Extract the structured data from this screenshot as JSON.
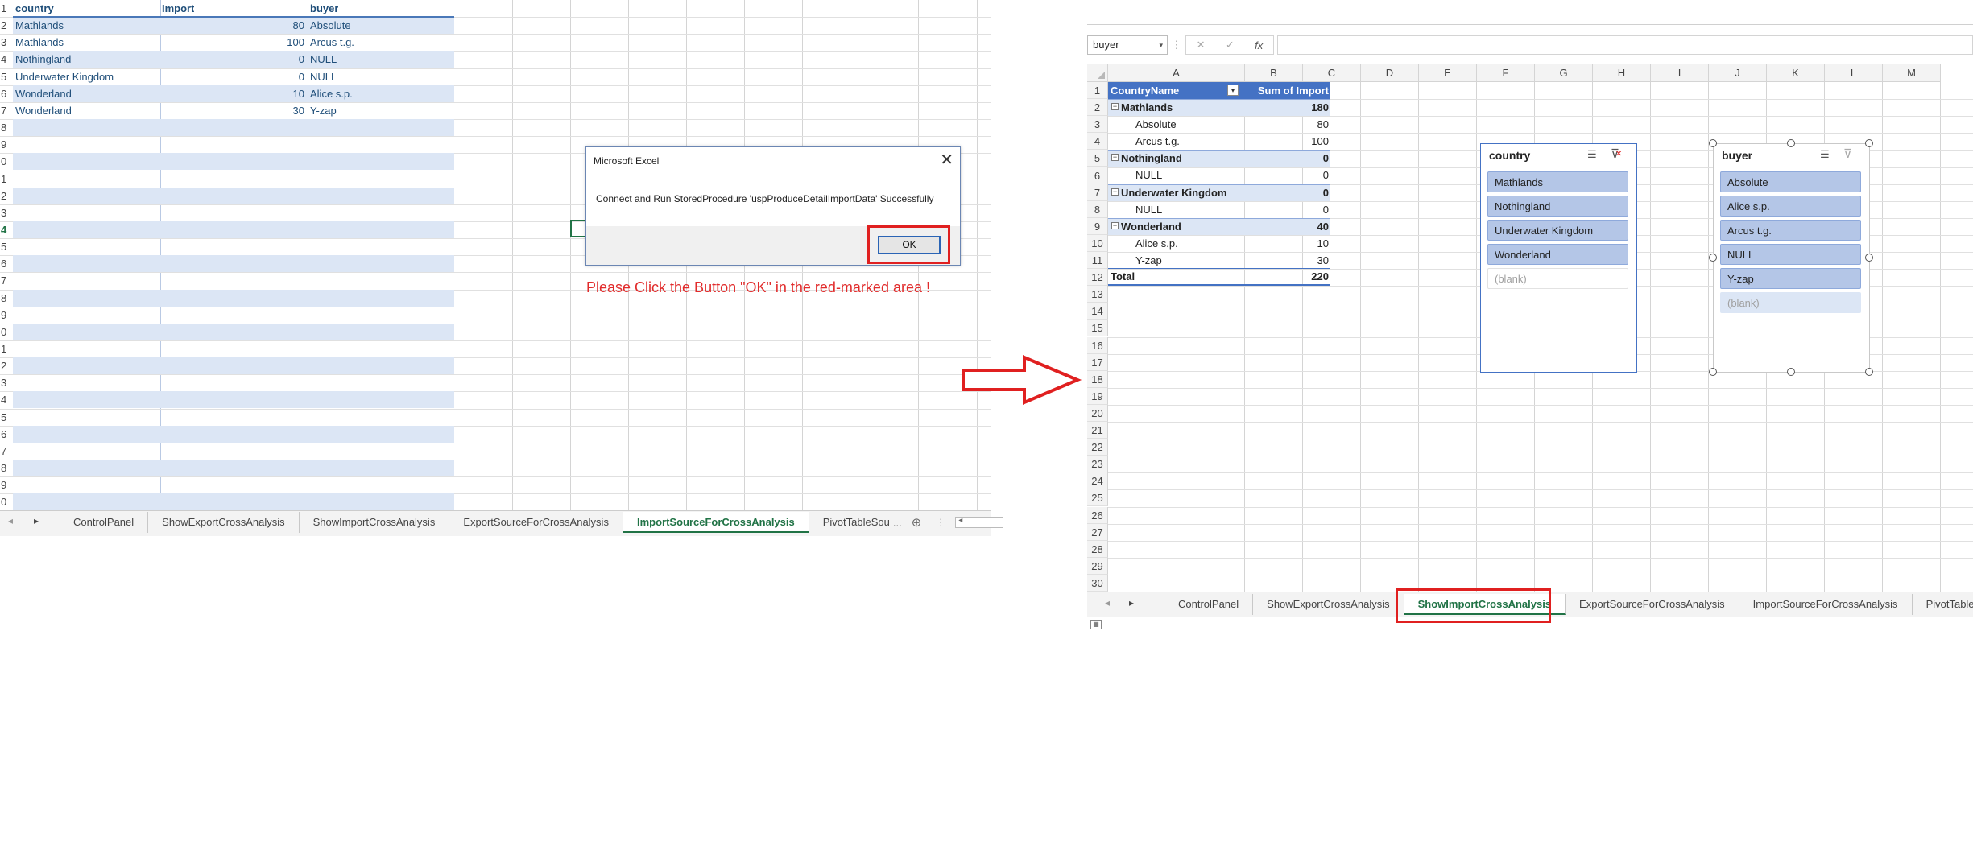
{
  "left": {
    "headers": [
      "country",
      "Import",
      "buyer"
    ],
    "rows": [
      {
        "country": "Mathlands",
        "import": "80",
        "buyer": "Absolute"
      },
      {
        "country": "Mathlands",
        "import": "100",
        "buyer": "Arcus t.g."
      },
      {
        "country": "Nothingland",
        "import": "0",
        "buyer": "NULL"
      },
      {
        "country": "Underwater Kingdom",
        "import": "0",
        "buyer": "NULL"
      },
      {
        "country": "Wonderland",
        "import": "10",
        "buyer": "Alice s.p."
      },
      {
        "country": "Wonderland",
        "import": "30",
        "buyer": "Y-zap"
      }
    ],
    "row_numbers": [
      "1",
      "2",
      "3",
      "4",
      "5",
      "6",
      "7",
      "8",
      "9",
      "0",
      "1",
      "2",
      "3",
      "4",
      "5",
      "6",
      "7",
      "8",
      "9",
      "0",
      "1",
      "2",
      "3",
      "4",
      "5",
      "6",
      "7",
      "8",
      "9",
      "0"
    ],
    "tabs": [
      "ControlPanel",
      "ShowExportCrossAnalysis",
      "ShowImportCrossAnalysis",
      "ExportSourceForCrossAnalysis",
      "ImportSourceForCrossAnalysis",
      "PivotTableSou"
    ],
    "tab_more": "..."
  },
  "dialog": {
    "title": "Microsoft Excel",
    "message": "Connect and Run StoredProcedure 'uspProduceDetailImportData' Successfully",
    "ok_label": "OK"
  },
  "note": "Please Click the Button \"OK\" in the red-marked area !",
  "right": {
    "name_box": "buyer",
    "fx": "fx",
    "columns": [
      "A",
      "B",
      "C",
      "D",
      "E",
      "F",
      "G",
      "H",
      "I",
      "J",
      "K",
      "L",
      "M"
    ],
    "row_numbers": [
      "1",
      "2",
      "3",
      "4",
      "5",
      "6",
      "7",
      "8",
      "9",
      "10",
      "11",
      "12",
      "13",
      "14",
      "15",
      "16",
      "17",
      "18",
      "19",
      "20",
      "21",
      "22",
      "23",
      "24",
      "25",
      "26",
      "27",
      "28",
      "29",
      "30"
    ],
    "pivot": {
      "header_row": [
        "CountryName",
        "Sum of Import"
      ],
      "rows": [
        {
          "label": "Mathlands",
          "value": "180",
          "group": true
        },
        {
          "label": "Absolute",
          "value": "80",
          "group": false
        },
        {
          "label": "Arcus t.g.",
          "value": "100",
          "group": false
        },
        {
          "label": "Nothingland",
          "value": "0",
          "group": true
        },
        {
          "label": "NULL",
          "value": "0",
          "group": false
        },
        {
          "label": "Underwater Kingdom",
          "value": "0",
          "group": true
        },
        {
          "label": "NULL",
          "value": "0",
          "group": false
        },
        {
          "label": "Wonderland",
          "value": "40",
          "group": true
        },
        {
          "label": "Alice s.p.",
          "value": "10",
          "group": false
        },
        {
          "label": "Y-zap",
          "value": "30",
          "group": false
        }
      ],
      "total_label": "Total",
      "total_value": "220"
    },
    "slicer_country": {
      "title": "country",
      "items": [
        "Mathlands",
        "Nothingland",
        "Underwater Kingdom",
        "Wonderland",
        "(blank)"
      ]
    },
    "slicer_buyer": {
      "title": "buyer",
      "items": [
        "Absolute",
        "Alice s.p.",
        "Arcus t.g.",
        "NULL",
        "Y-zap",
        "(blank)"
      ]
    },
    "tabs": [
      "ControlPanel",
      "ShowExportCrossAnalysis",
      "ShowImportCrossAnalysis",
      "ExportSourceForCrossAnalysis",
      "ImportSourceForCrossAnalysis",
      "PivotTableSou"
    ],
    "tab_more": "..."
  },
  "colors": {
    "highlight_red": "#e02020",
    "excel_green": "#217346",
    "band_blue": "#dce6f5",
    "slicer_blue": "#b4c6e7"
  }
}
